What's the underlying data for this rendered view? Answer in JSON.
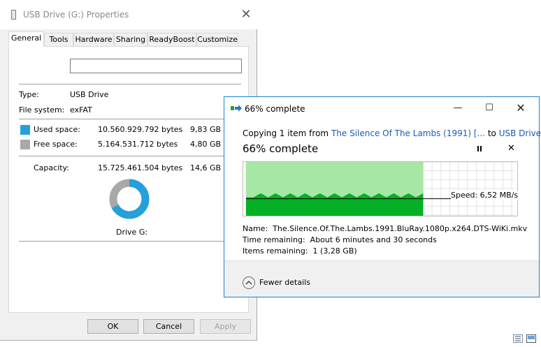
{
  "properties": {
    "title": "USB Drive (G:) Properties",
    "tabs": [
      {
        "label": "General",
        "active": true
      },
      {
        "label": "Tools",
        "active": false
      },
      {
        "label": "Hardware",
        "active": false
      },
      {
        "label": "Sharing",
        "active": false
      },
      {
        "label": "ReadyBoost",
        "active": false
      },
      {
        "label": "Customize",
        "active": false
      }
    ],
    "name_value": "",
    "type_label": "Type:",
    "type_value": "USB Drive",
    "fs_label": "File system:",
    "fs_value": "exFAT",
    "used_label": "Used space:",
    "used_bytes": "10.560.929.792 bytes",
    "used_size": "9,83 GB",
    "free_label": "Free space:",
    "free_bytes": "5.164.531.712 bytes",
    "free_size": "4,80 GB",
    "capacity_label": "Capacity:",
    "capacity_bytes": "15.725.461.504 bytes",
    "capacity_size": "14,6 GB",
    "drive_label": "Drive G:",
    "used_fraction": 0.6716,
    "used_color": "#26a0da",
    "free_color": "#a8a8a8",
    "ok_label": "OK",
    "cancel_label": "Cancel",
    "apply_label": "Apply"
  },
  "copy": {
    "title": "66% complete",
    "copying_prefix": "Copying 1 item from ",
    "source": "The Silence Of The Lambs (1991) [...",
    "to_word": " to ",
    "destination": "USB Drive (G:)",
    "headline": "66% complete",
    "progress_fraction": 0.66,
    "speed_text": "Speed: 6,52 MB/s",
    "name_label": "Name:",
    "name_value": "The.Silence.Of.The.Lambs.1991.BluRay.1080p.x264.DTS-WiKi.mkv",
    "time_label": "Time remaining:",
    "time_value": "About 6 minutes and 30 seconds",
    "items_label": "Items remaining:",
    "items_value": "1 (3,28 GB)",
    "fewer_label": "Fewer details",
    "fill_color": "#06b025",
    "area_color": "#a6e7a6"
  }
}
